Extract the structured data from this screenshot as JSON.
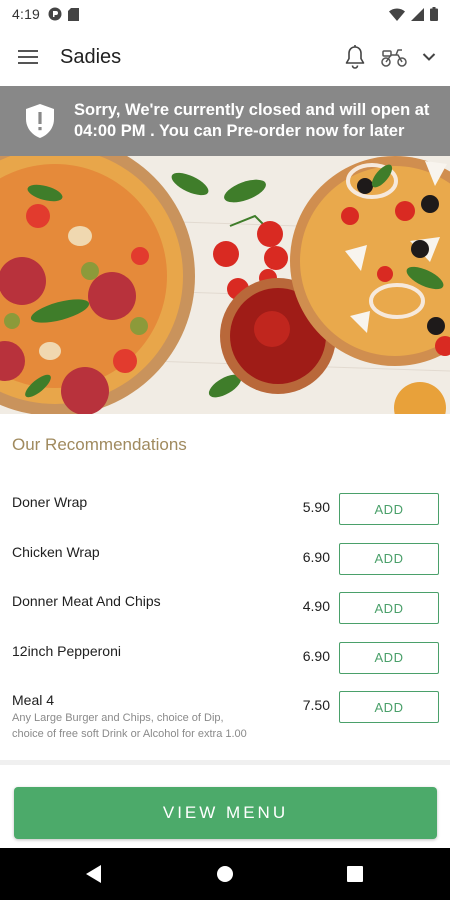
{
  "status_bar": {
    "time": "4:19"
  },
  "app_bar": {
    "title": "Sadies"
  },
  "banner": {
    "line1": "Sorry, We're currently closed and will open at",
    "line2": "04:00 PM . You can Pre-order now for later"
  },
  "recommendations": {
    "title": "Our Recommendations",
    "items": [
      {
        "name": "Doner Wrap",
        "price": "5.90",
        "add_label": "ADD"
      },
      {
        "name": "Chicken Wrap",
        "price": "6.90",
        "add_label": "ADD"
      },
      {
        "name": "Donner Meat And Chips",
        "price": "4.90",
        "add_label": "ADD"
      },
      {
        "name": "12inch Pepperoni",
        "price": "6.90",
        "add_label": "ADD"
      },
      {
        "name": "Meal 4",
        "price": "7.50",
        "add_label": "ADD",
        "desc_line1": "Any Large Burger and Chips, choice of Dip,",
        "desc_line2": "choice of free soft Drink or Alcohol for extra 1.00"
      }
    ]
  },
  "view_menu_label": "VIEW MENU",
  "colors": {
    "accent_green": "#4caa6a",
    "banner_grey": "#888888",
    "heading_gold": "#a08a5e"
  }
}
